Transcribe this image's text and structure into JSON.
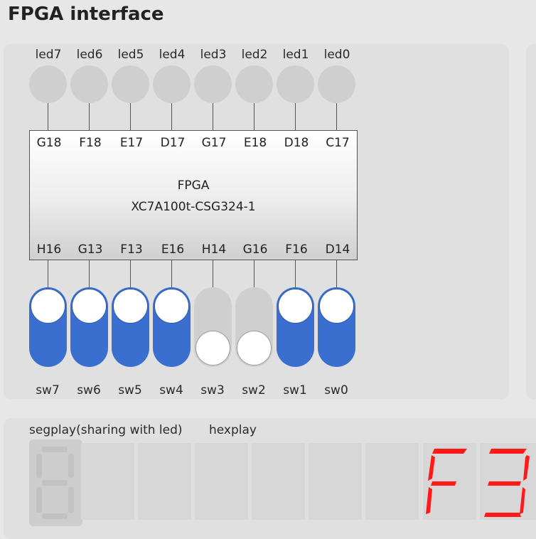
{
  "title": "FPGA interface",
  "leds": [
    {
      "name": "led7",
      "pin": "G18"
    },
    {
      "name": "led6",
      "pin": "F18"
    },
    {
      "name": "led5",
      "pin": "E17"
    },
    {
      "name": "led4",
      "pin": "D17"
    },
    {
      "name": "led3",
      "pin": "G17"
    },
    {
      "name": "led2",
      "pin": "E18"
    },
    {
      "name": "led1",
      "pin": "D18"
    },
    {
      "name": "led0",
      "pin": "C17"
    }
  ],
  "chip": {
    "line1": "FPGA",
    "line2": "XC7A100t-CSG324-1"
  },
  "switches": [
    {
      "name": "sw7",
      "pin": "H16",
      "on": true
    },
    {
      "name": "sw6",
      "pin": "G13",
      "on": true
    },
    {
      "name": "sw5",
      "pin": "F13",
      "on": true
    },
    {
      "name": "sw4",
      "pin": "E16",
      "on": true
    },
    {
      "name": "sw3",
      "pin": "H14",
      "on": false
    },
    {
      "name": "sw2",
      "pin": "G16",
      "on": false
    },
    {
      "name": "sw1",
      "pin": "F16",
      "on": true
    },
    {
      "name": "sw0",
      "pin": "D14",
      "on": true
    }
  ],
  "segplay_label": "segplay(sharing with led)",
  "hexplay_label": "hexplay",
  "hex_digits": [
    "F",
    "3"
  ],
  "colors": {
    "switch_on": "#3a6fd0",
    "switch_off": "#cfcfcf",
    "segment_on": "#ff1a1a",
    "segment_off": "#c2c2c2"
  }
}
